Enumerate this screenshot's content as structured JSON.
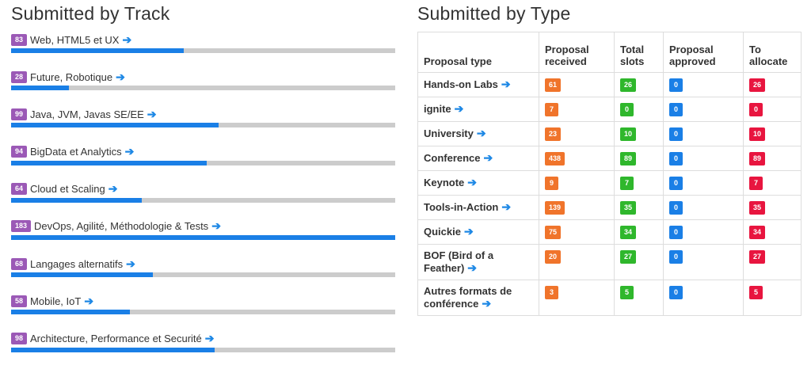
{
  "colors": {
    "badge": "#9b59b6",
    "bar_fill": "#1a7fe6",
    "bar_bg": "#cccccc",
    "arrow": "#1e88e5",
    "received": "#f0742b",
    "slots": "#2fb72c",
    "approved": "#1a7fe6",
    "allocate": "#e8153f"
  },
  "left": {
    "title": "Submitted by Track",
    "tracks": [
      {
        "count": "83",
        "label": "Web, HTML5 et UX",
        "fill": 0.45
      },
      {
        "count": "28",
        "label": "Future, Robotique",
        "fill": 0.15
      },
      {
        "count": "99",
        "label": "Java, JVM, Javas SE/EE",
        "fill": 0.54
      },
      {
        "count": "94",
        "label": "BigData et Analytics",
        "fill": 0.51
      },
      {
        "count": "64",
        "label": "Cloud et Scaling",
        "fill": 0.34
      },
      {
        "count": "183",
        "label": "DevOps, Agilité, Méthodologie & Tests",
        "fill": 1.0
      },
      {
        "count": "68",
        "label": "Langages alternatifs",
        "fill": 0.37
      },
      {
        "count": "58",
        "label": "Mobile, IoT",
        "fill": 0.31
      },
      {
        "count": "98",
        "label": "Architecture, Performance et Securité",
        "fill": 0.53
      }
    ]
  },
  "right": {
    "title": "Submitted by Type",
    "headers": [
      "Proposal type",
      "Proposal received",
      "Total slots",
      "Proposal approved",
      "To allocate"
    ],
    "rows": [
      {
        "type": "Hands-on Labs",
        "received": "61",
        "slots": "26",
        "approved": "0",
        "allocate": "26"
      },
      {
        "type": "ignite",
        "received": "7",
        "slots": "0",
        "approved": "0",
        "allocate": "0"
      },
      {
        "type": "University",
        "received": "23",
        "slots": "10",
        "approved": "0",
        "allocate": "10"
      },
      {
        "type": "Conference",
        "received": "438",
        "slots": "89",
        "approved": "0",
        "allocate": "89"
      },
      {
        "type": "Keynote",
        "received": "9",
        "slots": "7",
        "approved": "0",
        "allocate": "7"
      },
      {
        "type": "Tools-in-Action",
        "received": "139",
        "slots": "35",
        "approved": "0",
        "allocate": "35"
      },
      {
        "type": "Quickie",
        "received": "75",
        "slots": "34",
        "approved": "0",
        "allocate": "34"
      },
      {
        "type": "BOF (Bird of a Feather)",
        "received": "20",
        "slots": "27",
        "approved": "0",
        "allocate": "27"
      },
      {
        "type": "Autres formats de conférence",
        "received": "3",
        "slots": "5",
        "approved": "0",
        "allocate": "5"
      }
    ]
  },
  "arrow_glyph": "➔"
}
